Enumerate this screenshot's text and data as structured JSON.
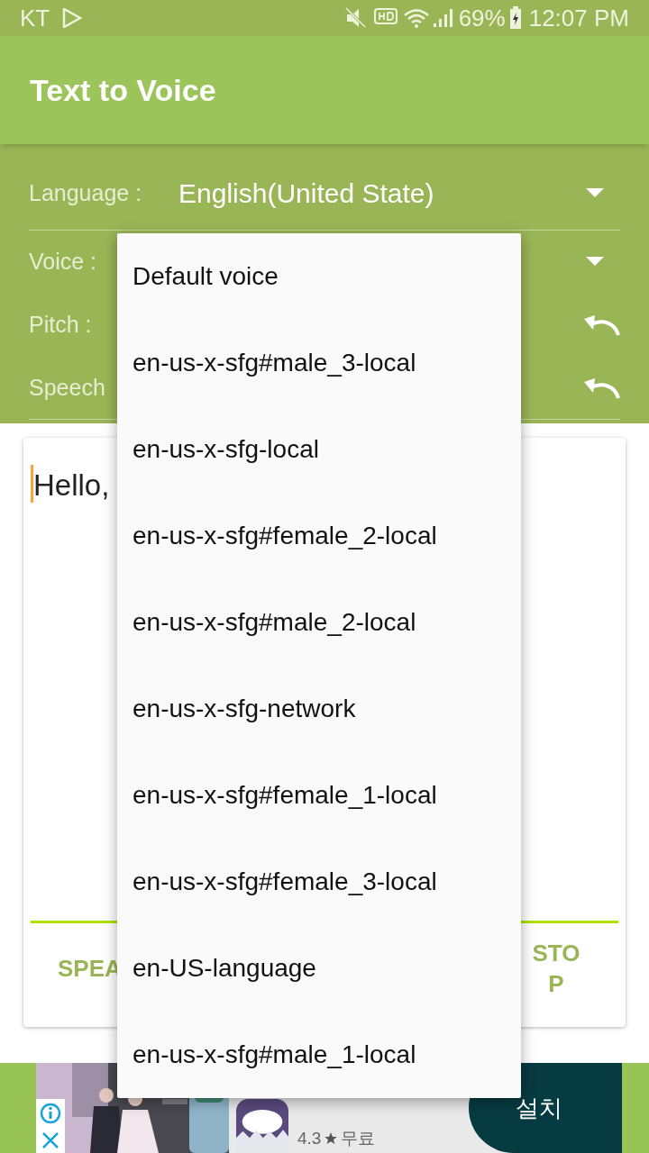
{
  "status_bar": {
    "carrier": "KT",
    "battery": "69%",
    "time": "12:07 PM"
  },
  "app_bar": {
    "title": "Text to Voice"
  },
  "settings": [
    {
      "kind": "dropdown",
      "label": "Language :",
      "value": "English(United State)"
    },
    {
      "kind": "dropdown",
      "label": "Voice :"
    },
    {
      "kind": "reset",
      "label": "Pitch :"
    },
    {
      "kind": "reset",
      "label": "Speech"
    }
  ],
  "text_area": {
    "value": "Hello,"
  },
  "buttons": [
    "SPEA",
    "STOP"
  ],
  "voice_menu": {
    "items": [
      {
        "label": "Default voice"
      },
      {
        "label": "en-us-x-sfg#male_3-local"
      },
      {
        "label": "en-us-x-sfg-local"
      },
      {
        "label": "en-us-x-sfg#female_2-local"
      },
      {
        "label": "en-us-x-sfg#male_2-local"
      },
      {
        "label": "en-us-x-sfg-network"
      },
      {
        "label": "en-us-x-sfg#female_1-local"
      },
      {
        "label": "en-us-x-sfg#female_3-local"
      },
      {
        "label": "en-US-language"
      },
      {
        "label": "en-us-x-sfg#male_1-local"
      }
    ]
  },
  "ad": {
    "rating": "4.3",
    "price": "무료",
    "install": "설치"
  }
}
